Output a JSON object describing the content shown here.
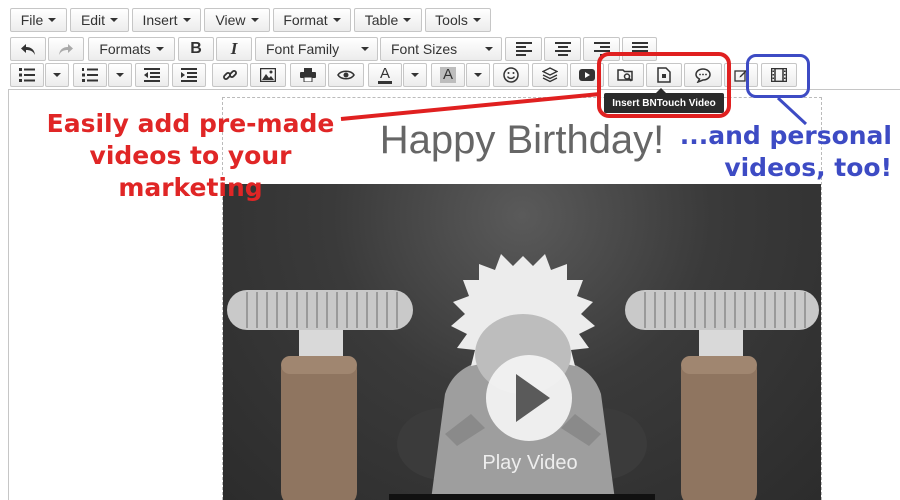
{
  "menubar": {
    "file": "File",
    "edit": "Edit",
    "insert": "Insert",
    "view": "View",
    "format": "Format",
    "table": "Table",
    "tools": "Tools"
  },
  "toolbar1": {
    "formats": "Formats",
    "bold": "B",
    "italic": "I",
    "font_family": "Font Family",
    "font_sizes": "Font Sizes"
  },
  "toolbar2": {
    "text_color": "A",
    "bg_color": "A"
  },
  "tooltip": {
    "text": "Insert BNTouch Video"
  },
  "annotations": {
    "red_line1": "Easily add pre-made",
    "red_line2": "videos to your marketing",
    "blue_line1": "...and personal",
    "blue_line2": "videos, too!"
  },
  "content": {
    "heading": "Happy Birthday!",
    "play_label": "Play Video"
  },
  "colors": {
    "annotation_red": "#e02020",
    "annotation_blue": "#3d4bc4"
  }
}
